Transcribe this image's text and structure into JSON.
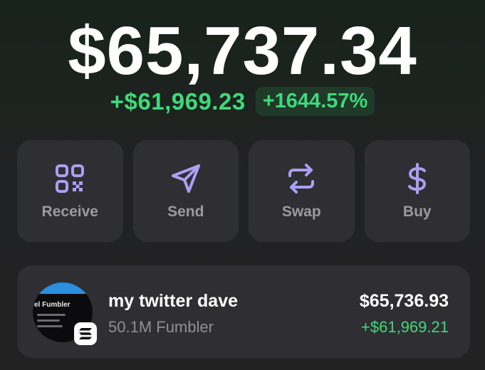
{
  "balance": {
    "total": "$65,737.34",
    "change_amount": "+$61,969.23",
    "change_percent": "+1644.57%"
  },
  "actions": [
    {
      "label": "Receive",
      "icon": "qr-code-icon"
    },
    {
      "label": "Send",
      "icon": "send-icon"
    },
    {
      "label": "Swap",
      "icon": "swap-icon"
    },
    {
      "label": "Buy",
      "icon": "dollar-icon"
    }
  ],
  "token": {
    "name": "my twitter dave",
    "amount": "50.1M Fumbler",
    "value": "$65,736.93",
    "change": "+$61,969.21",
    "avatar_text": "el Fumbler",
    "chain_icon": "solana-icon"
  },
  "colors": {
    "accent_purple": "#ab9ff2",
    "positive_green": "#3fd97a",
    "card_bg": "#2f2f33"
  }
}
